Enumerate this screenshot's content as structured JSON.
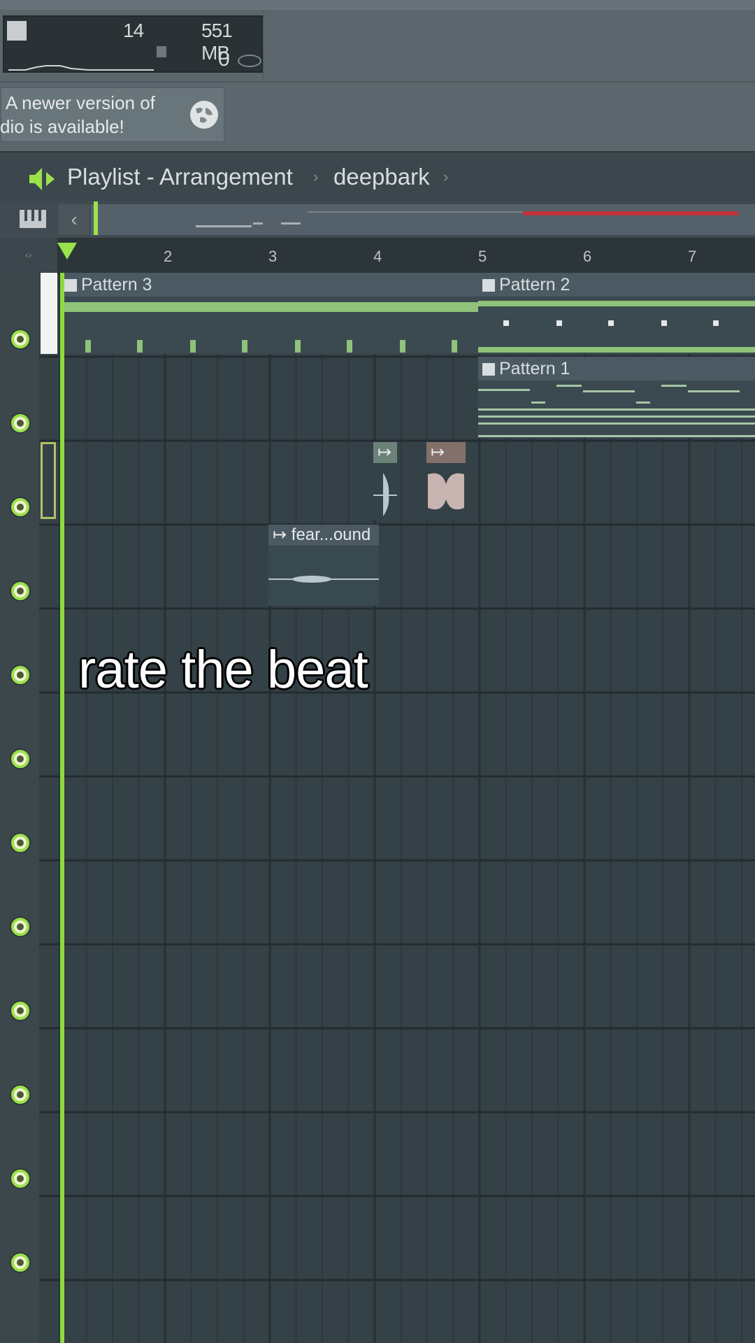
{
  "stats": {
    "cpu_count": "14",
    "ram": "551 MB",
    "polyphony": "0"
  },
  "notice": {
    "line1": "A newer version of",
    "line2": "dio is available!"
  },
  "playlist": {
    "title": "Playlist - Arrangement",
    "pattern": "deepbark",
    "separator": "›"
  },
  "ruler": {
    "bars": [
      "2",
      "3",
      "4",
      "5",
      "6",
      "7"
    ]
  },
  "clips": {
    "pattern3": "Pattern 3",
    "pattern2": "Pattern 2",
    "pattern1": "Pattern 1",
    "audio": "fear...ound"
  },
  "overlay": {
    "caption": "rate the beat"
  },
  "colors": {
    "accent": "#9be24a",
    "grid_bg": "#344147",
    "overview_red": "#c0313a"
  }
}
